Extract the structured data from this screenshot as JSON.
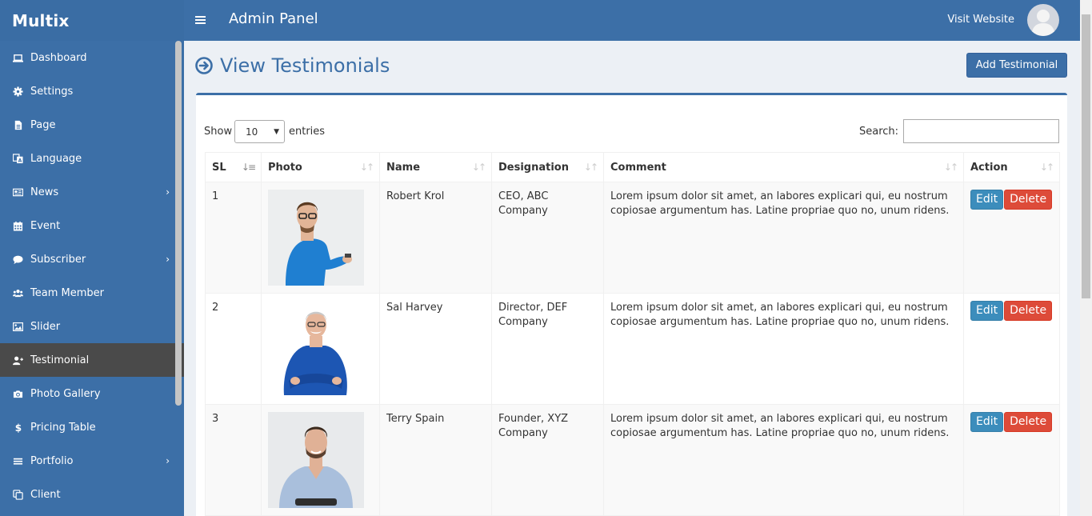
{
  "app": {
    "brand": "Multix",
    "panel_title": "Admin Panel",
    "visit_link": "Visit Website"
  },
  "sidebar": {
    "items": [
      {
        "label": "Dashboard",
        "icon": "laptop-icon"
      },
      {
        "label": "Settings",
        "icon": "gear-icon"
      },
      {
        "label": "Page",
        "icon": "file-icon"
      },
      {
        "label": "Language",
        "icon": "language-icon"
      },
      {
        "label": "News",
        "icon": "newspaper-icon",
        "has_submenu": true
      },
      {
        "label": "Event",
        "icon": "calendar-icon"
      },
      {
        "label": "Subscriber",
        "icon": "comment-icon",
        "has_submenu": true
      },
      {
        "label": "Team Member",
        "icon": "users-icon"
      },
      {
        "label": "Slider",
        "icon": "image-icon"
      },
      {
        "label": "Testimonial",
        "icon": "user-plus-icon",
        "active": true
      },
      {
        "label": "Photo Gallery",
        "icon": "camera-icon"
      },
      {
        "label": "Pricing Table",
        "icon": "dollar-icon"
      },
      {
        "label": "Portfolio",
        "icon": "bars-icon",
        "has_submenu": true
      },
      {
        "label": "Client",
        "icon": "copy-icon"
      }
    ],
    "chevron": "›"
  },
  "page": {
    "title": "View Testimonials",
    "add_button": "Add Testimonial"
  },
  "table_controls": {
    "show_label": "Show",
    "entries_value": "10",
    "entries_label": "entries",
    "search_label": "Search:",
    "search_value": ""
  },
  "table": {
    "headers": [
      "SL",
      "Photo",
      "Name",
      "Designation",
      "Comment",
      "Action"
    ],
    "rows": [
      {
        "sl": "1",
        "name": "Robert Krol",
        "designation": "CEO, ABC Company",
        "comment": "Lorem ipsum dolor sit amet, an labores explicari qui, eu nostrum copiosae argumentum has. Latine propriae quo no, unum ridens."
      },
      {
        "sl": "2",
        "name": "Sal Harvey",
        "designation": "Director, DEF Company",
        "comment": "Lorem ipsum dolor sit amet, an labores explicari qui, eu nostrum copiosae argumentum has. Latine propriae quo no, unum ridens."
      },
      {
        "sl": "3",
        "name": "Terry Spain",
        "designation": "Founder, XYZ Company",
        "comment": "Lorem ipsum dolor sit amet, an labores explicari qui, eu nostrum copiosae argumentum has. Latine propriae quo no, unum ridens."
      }
    ],
    "edit_label": "Edit",
    "delete_label": "Delete"
  },
  "colors": {
    "primary": "#3c6fa7",
    "active_item": "#4a4a4a",
    "edit": "#3c8dbc",
    "delete": "#dd4b39"
  }
}
